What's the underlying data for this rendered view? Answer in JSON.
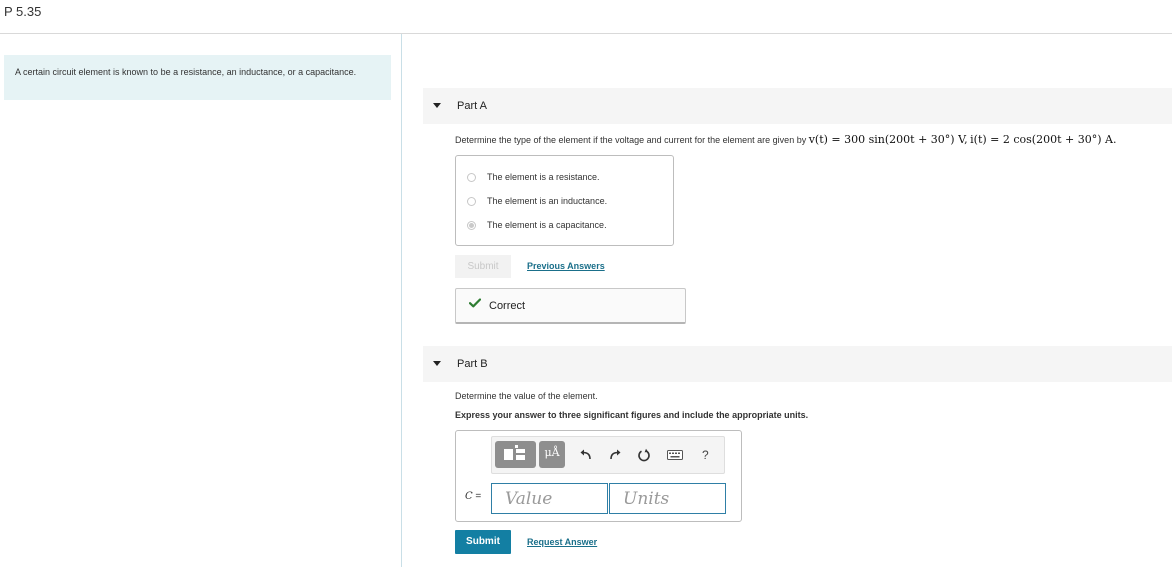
{
  "header": {
    "title": "P 5.35"
  },
  "intro": {
    "text": "A certain circuit element is known to be a resistance, an inductance, or a capacitance."
  },
  "part_a": {
    "label": "Part A",
    "question_text": "Determine the type of the element if the voltage and current for the element are given by",
    "equation_v": "v(t) = 300 sin(200t + 30°) V",
    "equation_sep": ",",
    "equation_i": "i(t) = 2 cos(200t + 30°) A",
    "equation_end": ".",
    "choices": [
      {
        "label": "The element is a resistance.",
        "selected": false
      },
      {
        "label": "The element is an inductance.",
        "selected": false
      },
      {
        "label": "The element is a capacitance.",
        "selected": true
      }
    ],
    "submit_label": "Submit",
    "previous_answers_label": "Previous Answers",
    "feedback": "Correct"
  },
  "part_b": {
    "label": "Part B",
    "question_text": "Determine the value of the element.",
    "instruction": "Express your answer to three significant figures and include the appropriate units.",
    "toolbar": {
      "templates_icon": "templates-icon",
      "units_label": "μÅ",
      "undo_icon": "undo-icon",
      "redo_icon": "redo-icon",
      "reset_icon": "reset-icon",
      "keyboard_icon": "keyboard-icon",
      "help_label": "?"
    },
    "variable": "C",
    "equals": " =",
    "value_placeholder": "Value",
    "units_placeholder": "Units",
    "submit_label": "Submit",
    "request_answer_label": "Request Answer"
  },
  "colors": {
    "accent": "#137fa3",
    "intro_bg": "#e6f3f5",
    "check": "#2e7d32",
    "link": "#1a6f8a"
  }
}
